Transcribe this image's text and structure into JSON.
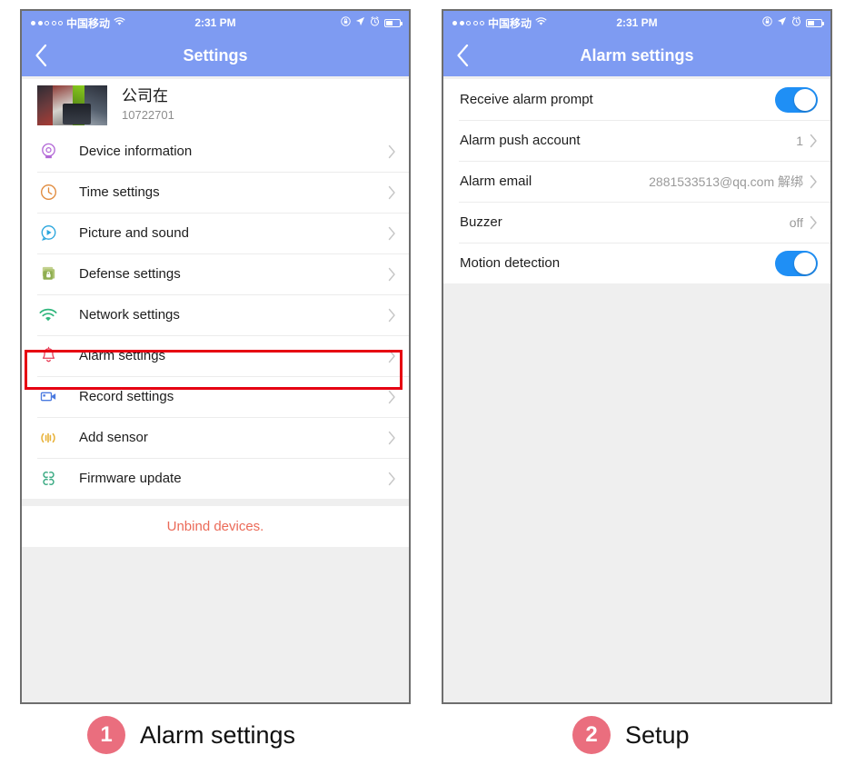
{
  "left_phone": {
    "status_bar": {
      "signal_dots_filled": 2,
      "signal_dots_total": 5,
      "carrier": "中国移动",
      "wifi_icon": "wifi-icon",
      "time": "2:31 PM",
      "lock_icon": "lock-icon",
      "location_icon": "location-arrow-icon",
      "alarm_icon": "alarm-clock-icon",
      "battery_icon": "battery-icon"
    },
    "nav": {
      "back_icon": "chevron-left-icon",
      "title": "Settings"
    },
    "profile": {
      "thumbnail": "device-snapshot-thumbnail",
      "name": "公司在",
      "device_id": "10722701"
    },
    "items": [
      {
        "label": "Device information",
        "icon": "camera-dome-icon",
        "color": "#b267d6"
      },
      {
        "label": "Time settings",
        "icon": "clock-icon",
        "color": "#e08a3c"
      },
      {
        "label": "Picture and sound",
        "icon": "play-circle-icon",
        "color": "#2ba6dd"
      },
      {
        "label": "Defense settings",
        "icon": "layers-lock-icon",
        "color": "#9bb564"
      },
      {
        "label": "Network settings",
        "icon": "wifi-icon",
        "color": "#2fb67c"
      },
      {
        "label": "Alarm settings",
        "icon": "bell-icon",
        "color": "#e8415a",
        "highlighted": true
      },
      {
        "label": "Record settings",
        "icon": "video-camera-icon",
        "color": "#4a7ae0"
      },
      {
        "label": "Add sensor",
        "icon": "sensor-signal-icon",
        "color": "#e8b23a"
      },
      {
        "label": "Firmware update",
        "icon": "firmware-chip-icon",
        "color": "#3cab84"
      }
    ],
    "unbind_label": "Unbind devices.",
    "unbind_color": "#eb6a58",
    "chevron_icon": "chevron-right-icon"
  },
  "right_phone": {
    "status_bar": {
      "signal_dots_filled": 2,
      "signal_dots_total": 5,
      "carrier": "中国移动",
      "wifi_icon": "wifi-icon",
      "time": "2:31 PM",
      "lock_icon": "lock-icon",
      "location_icon": "location-arrow-icon",
      "alarm_icon": "alarm-clock-icon",
      "battery_icon": "battery-icon"
    },
    "nav": {
      "back_icon": "chevron-left-icon",
      "title": "Alarm settings"
    },
    "items": [
      {
        "label": "Receive alarm prompt",
        "control": "toggle",
        "toggle_on": true
      },
      {
        "label": "Alarm  push account",
        "control": "value",
        "value": "1",
        "chevron": true
      },
      {
        "label": "Alarm email",
        "control": "value",
        "value": "2881533513@qq.com 解绑",
        "chevron": true
      },
      {
        "label": "Buzzer",
        "control": "value",
        "value": "off",
        "chevron": true
      },
      {
        "label": "Motion detection",
        "control": "toggle",
        "toggle_on": true
      }
    ],
    "chevron_icon": "chevron-right-icon",
    "toggle_on_color": "#1f8ff5"
  },
  "captions": [
    {
      "number": "1",
      "text": "Alarm settings"
    },
    {
      "number": "2",
      "text": "Setup"
    }
  ],
  "theme": {
    "nav_bar_color": "#7e9bf2",
    "page_background": "#efefef",
    "badge_color": "#ea6e7e",
    "highlight_color": "#e60012"
  }
}
